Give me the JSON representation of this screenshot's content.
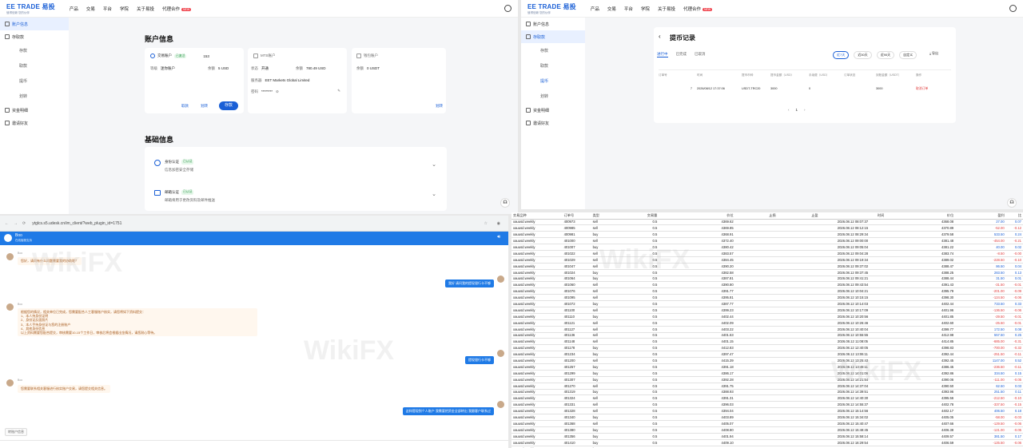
{
  "brand": {
    "name": "EE TRADE 易投",
    "tagline": "值得信赖 您的伙伴"
  },
  "nav": {
    "items": [
      "产品",
      "交易",
      "平台",
      "学院",
      "关于易投",
      "代理合作"
    ],
    "hot": "NEW"
  },
  "left_panel": {
    "sidebar": [
      {
        "label": "账户信息",
        "active": true
      },
      {
        "label": "存取款",
        "active": false
      },
      {
        "label": "存款",
        "sub": true
      },
      {
        "label": "取款",
        "sub": true
      },
      {
        "label": "提币",
        "sub": true
      },
      {
        "label": "划转",
        "sub": true
      },
      {
        "label": "资金明细",
        "active": false
      },
      {
        "label": "邀请好友",
        "active": false
      }
    ],
    "account_title": "账户信息",
    "trade_account": {
      "label": "交易账户",
      "status": "已激活",
      "number": "153",
      "level_label": "等级",
      "level": "迷你账户",
      "balance_label": "余额",
      "balance": "5 USD",
      "withdraw": "取款",
      "transfer": "划转",
      "deposit": "存款"
    },
    "mts_account": {
      "label": "MTS账户",
      "status_label": "状态",
      "status": "开通",
      "balance_label": "余额",
      "balance": "780.49 USD",
      "server_label": "服务器",
      "server": "EET Markets Global Limited",
      "password_label": "密码",
      "password": "********",
      "transfer": "划转"
    },
    "wallet": {
      "label": "钱包账户",
      "balance_label": "余额",
      "balance": "0 USDT",
      "transfer": "划转"
    },
    "basic_title": "基础信息",
    "id_verify": {
      "title": "身份认证",
      "status": "已认证",
      "desc": "信息加密安全存储"
    },
    "email_verify": {
      "title": "邮箱认证",
      "status": "已认证",
      "desc": "邮箱将用于更改资料及邮件推送"
    }
  },
  "right_panel": {
    "sidebar": [
      {
        "label": "账户信息"
      },
      {
        "label": "存取款",
        "active": true
      },
      {
        "label": "存款",
        "sub": true
      },
      {
        "label": "取款",
        "sub": true
      },
      {
        "label": "提币",
        "sub": true,
        "active": true
      },
      {
        "label": "划转",
        "sub": true
      },
      {
        "label": "资金明细"
      },
      {
        "label": "邀请好友"
      }
    ],
    "title": "提币记录",
    "tabs": [
      "进行中",
      "已完成",
      "已取消"
    ],
    "filters": [
      "近7天",
      "近30天",
      "近90天",
      "自定义"
    ],
    "export": "导出",
    "headers": [
      "订单号",
      "时间",
      "提币币种",
      "提币金额（USD）",
      "手续费（USD）",
      "订单状态",
      "到账金额（USDT）",
      "操作"
    ],
    "row": {
      "order": "7",
      "time": "2026/08/12 17:37:06",
      "coin": "USDT-TRC20",
      "amount": "3000",
      "fee": "0",
      "status": "",
      "received": "3000",
      "action": "取消订单"
    },
    "page": "1"
  },
  "chat": {
    "url": "ytglcs.s5.udesk.cn/im_client/?web_plugin_id=1751",
    "agent": "Boo",
    "agent_status": "在线客服支持",
    "footer": "转账户信息",
    "messages": [
      {
        "side": "left",
        "name": "Boo",
        "text": "您好，请问有什么问题需要我的协助呢？"
      },
      {
        "side": "right",
        "text": "我好 请问我的提现银行卡不够"
      },
      {
        "side": "left",
        "name": "Boo",
        "text": "根据您的情况，相关单位已完成，您需要配合人工客服账户核实，请您将如下资料提交：\n1、本人持身份证明\n2、身份证反面照片\n3、本人手持身份证与您的注册账户\n4、其他身份信息\n以上资料需要您配合提交，审核需要10-15个工作日，审核后将会根据出金情况，请您耐心等待。"
      },
      {
        "side": "right",
        "text": "提现银行卡不够"
      },
      {
        "side": "left",
        "name": "Boo",
        "text": "您需要联系相关客服进行核实账户交易，请您提交相关信息。"
      },
      {
        "side": "right",
        "text": "这样提现到个人账户 我需要把资金全部转出 我跟客户联系过"
      }
    ]
  },
  "trades": {
    "headers": [
      "交易品种",
      "订单号",
      "类型",
      "交易量",
      "价位",
      "止损",
      "止盈",
      "时间",
      "价位",
      "盈利",
      "比"
    ],
    "rows": [
      [
        "xauusd.weekly",
        "400973",
        "sell",
        "0.5",
        "4369.62",
        "",
        "",
        "2026.08.12 08:07:37",
        "4368.08",
        "27.00",
        "0.07"
      ],
      [
        "xauusd.weekly",
        "400985",
        "sell",
        "0.5",
        "4369.85",
        "",
        "",
        "2026.08.12 08:12:15",
        "4370.89",
        "-52.00",
        "-0.12"
      ],
      [
        "xauusd.weekly",
        "400981",
        "buy",
        "0.5",
        "4368.91",
        "",
        "",
        "2026.08.12 08:29:34",
        "4379.58",
        "533.50",
        "0.24"
      ],
      [
        "xauusd.weekly",
        "401000",
        "sell",
        "0.5",
        "4372.40",
        "",
        "",
        "2026.08.12 09:00:00",
        "4381.48",
        "-454.00",
        "-0.21"
      ],
      [
        "xauusd.weekly",
        "401007",
        "buy",
        "0.5",
        "4380.42",
        "",
        "",
        "2026.08.12 09:05:04",
        "4381.22",
        "40.00",
        "0.02"
      ],
      [
        "xauusd.weekly",
        "401022",
        "sell",
        "0.5",
        "4383.57",
        "",
        "",
        "2026.08.12 09:04:28",
        "4383.74",
        "-8.50",
        "-0.00"
      ],
      [
        "xauusd.weekly",
        "401029",
        "sell",
        "0.5",
        "4384.45",
        "",
        "",
        "2026.08.12 09:19:34",
        "4389.02",
        "-228.50",
        "-0.10"
      ],
      [
        "xauusd.weekly",
        "401047",
        "sell",
        "0.5",
        "4390.20",
        "",
        "",
        "2026.08.12 09:37:02",
        "4388.47",
        "86.50",
        "0.04"
      ],
      [
        "xauusd.weekly",
        "401024",
        "buy",
        "0.5",
        "4382.58",
        "",
        "",
        "2026.08.12 09:37:45",
        "4388.25",
        "283.50",
        "0.13"
      ],
      [
        "xauusd.weekly",
        "401064",
        "buy",
        "0.5",
        "4387.81",
        "",
        "",
        "2026.08.12 09:41:21",
        "4388.44",
        "31.50",
        "0.01"
      ],
      [
        "xauusd.weekly",
        "401060",
        "sell",
        "0.5",
        "4390.80",
        "",
        "",
        "2026.08.12 09:43:54",
        "4391.43",
        "-31.50",
        "-0.01"
      ],
      [
        "xauusd.weekly",
        "401076",
        "sell",
        "0.5",
        "4391.77",
        "",
        "",
        "2026.08.12 10:04:21",
        "4395.79",
        "-201.00",
        "-0.09"
      ],
      [
        "xauusd.weekly",
        "401095",
        "sell",
        "0.5",
        "4395.81",
        "",
        "",
        "2026.08.12 10:15:15",
        "4398.30",
        "-124.50",
        "-0.06"
      ],
      [
        "xauusd.weekly",
        "401072",
        "buy",
        "0.5",
        "4387.77",
        "",
        "",
        "2026.08.12 10:14:03",
        "4402.44",
        "733.50",
        "0.33"
      ],
      [
        "xauusd.weekly",
        "401100",
        "sell",
        "0.5",
        "4399.23",
        "",
        "",
        "2026.08.12 10:17:09",
        "4401.96",
        "-136.50",
        "-0.06"
      ],
      [
        "xauusd.weekly",
        "401110",
        "buy",
        "0.5",
        "4402.44",
        "",
        "",
        "2026.08.12 10:20:56",
        "4401.85",
        "-29.50",
        "-0.01"
      ],
      [
        "xauusd.weekly",
        "401121",
        "sell",
        "0.5",
        "4402.09",
        "",
        "",
        "2026.08.12 10:26:46",
        "4402.60",
        "-25.50",
        "-0.01"
      ],
      [
        "xauusd.weekly",
        "401127",
        "sell",
        "0.5",
        "4403.22",
        "",
        "",
        "2026.08.12 10:40:04",
        "4399.77",
        "172.50",
        "0.08"
      ],
      [
        "xauusd.weekly",
        "401136",
        "sell",
        "0.5",
        "4401.63",
        "",
        "",
        "2026.08.12 10:55:55",
        "4412.98",
        "557.50",
        "0.25"
      ],
      [
        "xauusd.weekly",
        "401148",
        "sell",
        "0.5",
        "4401.15",
        "",
        "",
        "2026.08.12 11:08:05",
        "4414.85",
        "-685.00",
        "-0.31"
      ],
      [
        "xauusd.weekly",
        "401178",
        "buy",
        "0.5",
        "4412.83",
        "",
        "",
        "2026.08.12 12:40:05",
        "4398.83",
        "-700.00",
        "-0.32"
      ],
      [
        "xauusd.weekly",
        "401234",
        "buy",
        "0.5",
        "4397.47",
        "",
        "",
        "2026.08.12 13:06:11",
        "4392.44",
        "-251.50",
        "-0.11"
      ],
      [
        "xauusd.weekly",
        "401200",
        "sell",
        "0.5",
        "4415.39",
        "",
        "",
        "2026.08.12 13:25:43",
        "4392.45",
        "1147.00",
        "0.52"
      ],
      [
        "xauusd.weekly",
        "401257",
        "buy",
        "0.5",
        "4391.18",
        "",
        "",
        "2026.08.12 13:48:11",
        "4386.45",
        "-236.50",
        "-0.11"
      ],
      [
        "xauusd.weekly",
        "401299",
        "buy",
        "0.5",
        "4386.17",
        "",
        "",
        "2026.08.12 14:01:06",
        "4392.86",
        "334.50",
        "0.15"
      ],
      [
        "xauusd.weekly",
        "401307",
        "buy",
        "0.5",
        "4392.28",
        "",
        "",
        "2026.08.12 14:21:54",
        "4390.06",
        "-111.00",
        "-0.05"
      ],
      [
        "xauusd.weekly",
        "401270",
        "sell",
        "0.5",
        "4391.75",
        "",
        "",
        "2026.08.12 14:37:04",
        "4390.50",
        "62.50",
        "0.03"
      ],
      [
        "xauusd.weekly",
        "401319",
        "buy",
        "0.5",
        "4388.93",
        "",
        "",
        "2026.08.12 14:39:51",
        "4393.96",
        "251.50",
        "0.11"
      ],
      [
        "xauusd.weekly",
        "401324",
        "sell",
        "0.5",
        "4391.31",
        "",
        "",
        "2026.08.12 14:40:30",
        "4395.56",
        "-212.50",
        "-0.10"
      ],
      [
        "xauusd.weekly",
        "401331",
        "sell",
        "0.5",
        "4396.03",
        "",
        "",
        "2026.08.12 14:55:37",
        "4402.78",
        "-337.50",
        "-0.15"
      ],
      [
        "xauusd.weekly",
        "401328",
        "sell",
        "0.5",
        "4394.04",
        "",
        "",
        "2026.08.12 15:14:56",
        "4402.17",
        "406.50",
        "0.18"
      ],
      [
        "xauusd.weekly",
        "401340",
        "buy",
        "0.5",
        "4403.89",
        "",
        "",
        "2026.08.12 15:34:02",
        "4405.05",
        "-58.00",
        "-0.03"
      ],
      [
        "xauusd.weekly",
        "401368",
        "sell",
        "0.5",
        "4405.07",
        "",
        "",
        "2026.08.12 15:40:47",
        "4407.66",
        "-129.50",
        "-0.06"
      ],
      [
        "xauusd.weekly",
        "401380",
        "buy",
        "0.5",
        "4408.80",
        "",
        "",
        "2026.08.12 15:48:45",
        "4406.38",
        "-121.00",
        "-0.05"
      ],
      [
        "xauusd.weekly",
        "401356",
        "buy",
        "0.5",
        "4401.94",
        "",
        "",
        "2026.08.12 15:58:14",
        "4409.57",
        "381.50",
        "0.17"
      ],
      [
        "xauusd.weekly",
        "401410",
        "buy",
        "0.5",
        "4409.10",
        "",
        "",
        "2026.08.12 16:29:54",
        "4406.59",
        "-125.50",
        "-0.06"
      ],
      [
        "xauusd.weekly",
        "401429",
        "buy",
        "0.5",
        "4409.11",
        "",
        "",
        "2026.08.12 17:04:58",
        "4406.61",
        "-125.00",
        "-0.06"
      ]
    ]
  },
  "watermark": "WikiFX"
}
